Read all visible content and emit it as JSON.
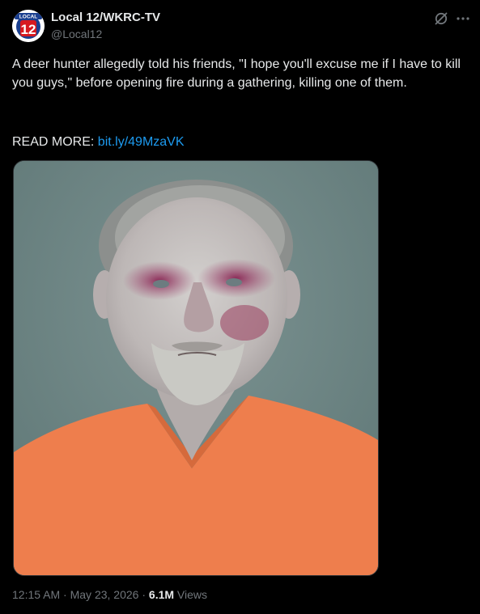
{
  "author": {
    "name": "Local 12/WKRC-TV",
    "handle": "@Local12",
    "logo_top_text": "LOCAL",
    "logo_number": "12",
    "logo_colors": {
      "red": "#d71920",
      "blue": "#1b3f8f",
      "white": "#ffffff"
    }
  },
  "header": {
    "grok_icon": "grok-icon",
    "more_icon": "more-horizontal-icon"
  },
  "tweet": {
    "text": "A deer hunter allegedly told his friends, \"I hope you'll excuse me if I have to kill you guys,\" before opening fire during a gathering, killing one of them.",
    "read_more_label": "READ MORE:",
    "read_more_link": "bit.ly/49MzaVK"
  },
  "media": {
    "description_icon": "mugshot-photo",
    "background_color": "#6f8785",
    "shirt_color": "#ee7e4d"
  },
  "meta": {
    "time": "12:15 AM",
    "separator": "·",
    "date": "May 23, 2026",
    "views_count": "6.1M",
    "views_label": "Views"
  },
  "colors": {
    "background": "#000000",
    "text": "#e7e9ea",
    "secondary": "#71767b",
    "link": "#1d9bf0"
  }
}
